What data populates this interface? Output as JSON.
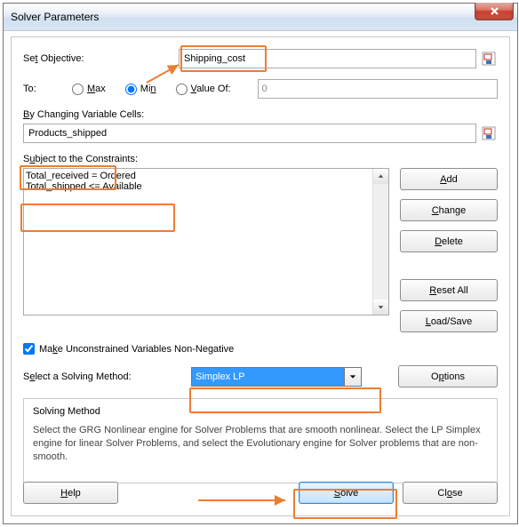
{
  "window": {
    "title": "Solver Parameters"
  },
  "objective": {
    "label_pre": "Se",
    "label_accel": "t",
    "label_post": " Objective:",
    "value": "Shipping_cost"
  },
  "to": {
    "label": "To:",
    "max_accel": "M",
    "max_post": "ax",
    "min_pre": "Mi",
    "min_accel": "n",
    "valueof_accel": "V",
    "valueof_post": "alue Of:",
    "value": "0",
    "selected": "Min"
  },
  "by_changing": {
    "accel": "B",
    "post": "y Changing Variable Cells:",
    "value": "Products_shipped"
  },
  "constraints": {
    "label_pre": "S",
    "label_accel": "u",
    "label_post": "bject to the Constraints:",
    "items": [
      "Total_received = Ordered",
      "Total_shipped <= Available"
    ]
  },
  "buttons": {
    "add": {
      "accel": "A",
      "post": "dd"
    },
    "change": {
      "accel": "C",
      "post": "hange"
    },
    "delete": {
      "accel": "D",
      "post": "elete"
    },
    "reset": {
      "accel": "R",
      "post": "eset All"
    },
    "load": {
      "accel": "L",
      "post": "oad/Save"
    },
    "options": {
      "pre": "O",
      "accel": "p",
      "post": "tions"
    },
    "help": {
      "accel": "H",
      "post": "elp"
    },
    "solve": {
      "accel": "S",
      "post": "olve"
    },
    "close": {
      "pre": "Cl",
      "accel": "o",
      "post": "se"
    }
  },
  "nonneg": {
    "pre": "Ma",
    "accel": "k",
    "post": "e Unconstrained Variables Non-Negative",
    "checked": true
  },
  "method": {
    "label_pre": "S",
    "label_accel": "e",
    "label_post": "lect a Solving Method:",
    "selected": "Simplex LP"
  },
  "info": {
    "title": "Solving Method",
    "text": "Select the GRG Nonlinear engine for Solver Problems that are smooth nonlinear. Select the LP Simplex engine for linear Solver Problems, and select the Evolutionary engine for Solver problems that are non-smooth."
  }
}
